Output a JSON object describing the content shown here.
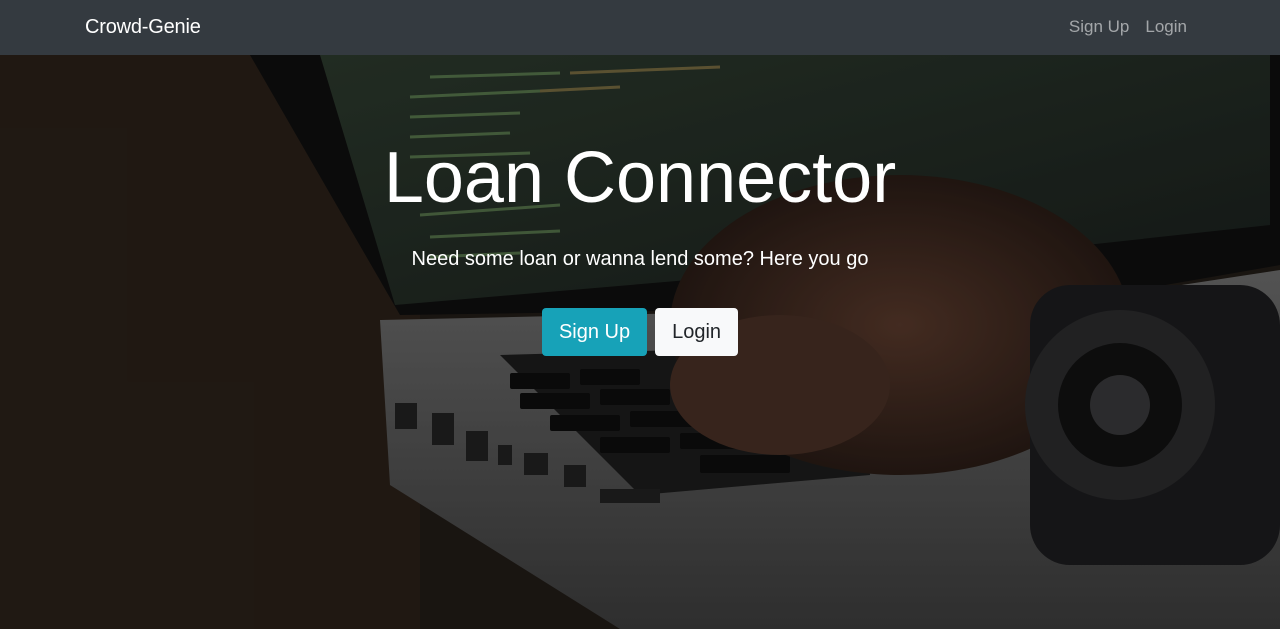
{
  "navbar": {
    "brand": "Crowd-Genie",
    "links": [
      {
        "label": "Sign Up"
      },
      {
        "label": "Login"
      }
    ]
  },
  "hero": {
    "title": "Loan Connector",
    "subtitle": "Need some loan or wanna lend some? Here you go",
    "signup_label": "Sign Up",
    "login_label": "Login"
  },
  "colors": {
    "navbar_bg": "#343a40",
    "signup_button": "#17a2b8",
    "login_button": "#f8f9fa"
  }
}
